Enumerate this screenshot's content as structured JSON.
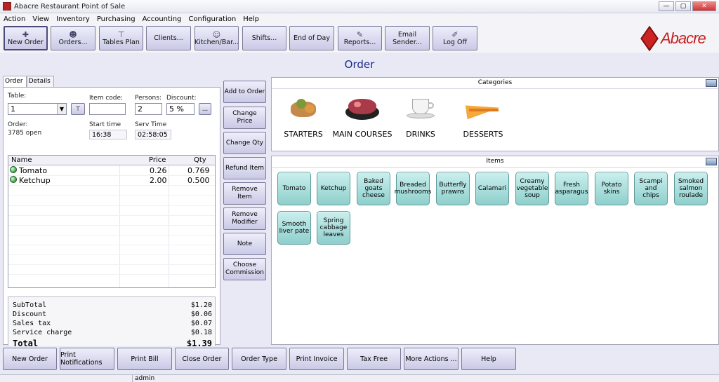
{
  "window": {
    "title": "Abacre Restaurant Point of Sale",
    "minimize": "—",
    "maximize": "▢",
    "close": "✕"
  },
  "menu": [
    "Action",
    "View",
    "Inventory",
    "Purchasing",
    "Accounting",
    "Configuration",
    "Help"
  ],
  "toolbar": {
    "new_order": "New Order",
    "orders": "Orders...",
    "tables_plan": "Tables Plan",
    "clients": "Clients...",
    "kitchen_bar": "Kitchen/Bar...",
    "shifts": "Shifts...",
    "end_of_day": "End of Day",
    "reports": "Reports...",
    "email_sender_1": "Email",
    "email_sender_2": "Sender...",
    "log_off": "Log Off"
  },
  "logo": {
    "text": "Abacre"
  },
  "page": {
    "title": "Order"
  },
  "tabs": [
    "Order",
    "Details"
  ],
  "order": {
    "table_label": "Table:",
    "table_value": "1",
    "item_code_label": "Item code:",
    "item_code_value": "",
    "persons_label": "Persons:",
    "persons_value": "2",
    "discount_label": "Discount:",
    "discount_value": "5 %",
    "discount_btn": "...",
    "order_label": "Order:",
    "order_value": "3785 open",
    "start_time_label": "Start time",
    "start_time_value": "16:38",
    "serv_time_label": "Serv Time",
    "serv_time_value": "02:58:05"
  },
  "grid": {
    "headers": {
      "name": "Name",
      "price": "Price",
      "qty": "Qty"
    },
    "rows": [
      {
        "name": "Tomato",
        "price": "0.26",
        "qty": "0.769"
      },
      {
        "name": "Ketchup",
        "price": "2.00",
        "qty": "0.500"
      }
    ]
  },
  "totals": {
    "subtotal_label": "SubTotal",
    "subtotal": "$1.20",
    "discount_label": "Discount",
    "discount": "$0.06",
    "sales_tax_label": "Sales tax",
    "sales_tax": "$0.07",
    "service_label": "Service charge",
    "service": "$0.18",
    "total_label": "Total",
    "total": "$1.39"
  },
  "actions": {
    "add": "Add to Order",
    "change_price": "Change Price",
    "change_qty": "Change Qty",
    "refund": "Refund Item",
    "remove_item_1": "Remove",
    "remove_item_2": "Item",
    "remove_mod_1": "Remove",
    "remove_mod_2": "Modifier",
    "note": "Note",
    "commission_1": "Choose",
    "commission_2": "Commission"
  },
  "categories": {
    "header": "Categories",
    "items": [
      "STARTERS",
      "MAIN COURSES",
      "DRINKS",
      "DESSERTS"
    ]
  },
  "items": {
    "header": "Items",
    "list": [
      [
        "Tomato"
      ],
      [
        "Ketchup"
      ],
      [
        "Baked",
        "goats",
        "cheese"
      ],
      [
        "Breaded",
        "mushrooms"
      ],
      [
        "Butterfly",
        "prawns"
      ],
      [
        "Calamari"
      ],
      [
        "Creamy",
        "vegetable",
        "soup"
      ],
      [
        "Fresh",
        "asparagus"
      ],
      [
        "Potato",
        "skins"
      ],
      [
        "Scampi and",
        "chips"
      ],
      [
        "Smoked",
        "salmon",
        "roulade"
      ],
      [
        "Smooth",
        "liver pate"
      ],
      [
        "Spring",
        "cabbage",
        "leaves"
      ]
    ]
  },
  "bottom": {
    "new_order": "New Order",
    "print_notifications": "Print Notifications",
    "print_bill": "Print Bill",
    "close_order": "Close Order",
    "order_type": "Order Type",
    "print_invoice": "Print Invoice",
    "tax_free": "Tax Free",
    "more_actions": "More Actions ...",
    "help": "Help"
  },
  "status": {
    "user": "admin"
  },
  "colors": {
    "accent_title": "#1a2a8a",
    "item_button": "#a8dedb",
    "logo_red": "#c81e1e"
  }
}
